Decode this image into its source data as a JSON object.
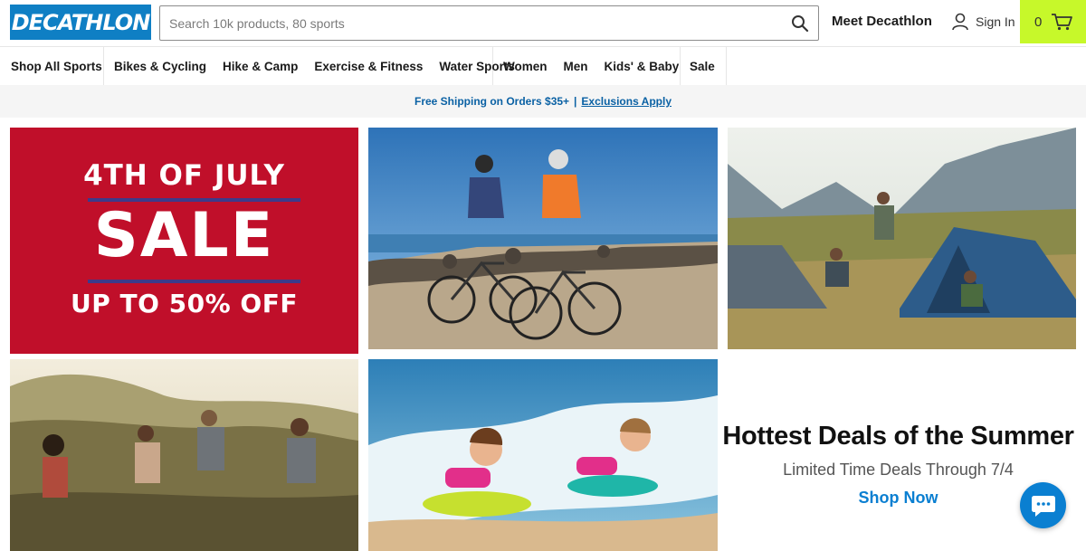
{
  "header": {
    "logo_text": "DECATHLON",
    "search_placeholder": "Search 10k products, 80 sports",
    "meet_label": "Meet Decathlon",
    "signin_label": "Sign In",
    "cart_count": "0"
  },
  "nav": {
    "shop_all": "Shop All Sports",
    "sports": [
      "Bikes & Cycling",
      "Hike & Camp",
      "Exercise & Fitness",
      "Water Sports"
    ],
    "people": [
      "Women",
      "Men",
      "Kids' & Baby"
    ],
    "sale": "Sale"
  },
  "promo": {
    "text": "Free Shipping on Orders $35+",
    "separator": "|",
    "link": "Exclusions Apply"
  },
  "hero": {
    "line1": "4TH OF JULY",
    "line2": "SALE",
    "line3": "UP TO 50% OFF"
  },
  "deals": {
    "headline": "Hottest Deals of the Summer",
    "subtext": "Limited Time Deals Through 7/4",
    "cta": "Shop Now"
  },
  "colors": {
    "brand_blue": "#0f7fc4",
    "cart_green": "#c7f82a",
    "sale_red": "#c00f2a",
    "link_blue": "#0a7fd1"
  },
  "icons": [
    "search-icon",
    "user-icon",
    "cart-icon",
    "chat-icon"
  ]
}
